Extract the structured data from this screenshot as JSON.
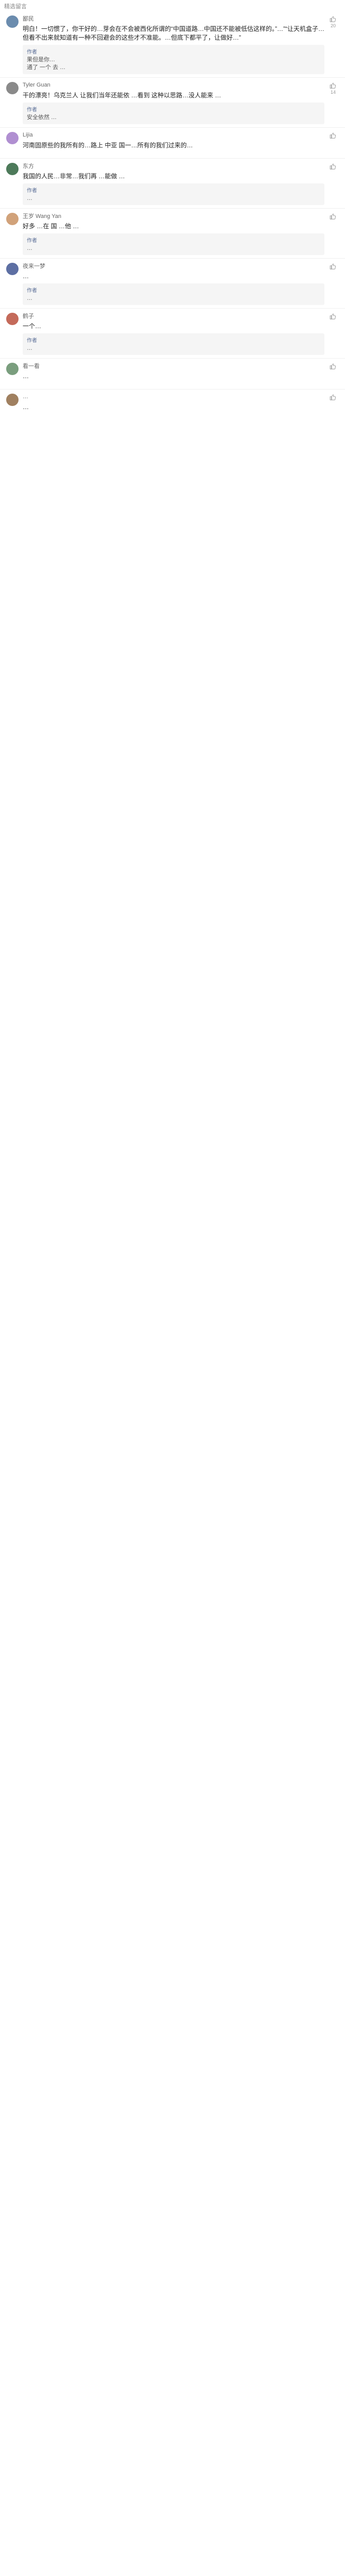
{
  "header": {
    "title": "精选留言"
  },
  "comments": [
    {
      "name": "鄙民",
      "avatar_color": "#6b8cae",
      "likes": "20",
      "text": "明白！一切惯了，你干好的…芽会在不会被西化所谓的“中国道路…中国还不能被低估这样的。”…”“让天机盒子…但看不出来就知道有一种不回避会的这些才不准能。…但底下都平了，让做好…”",
      "quote": {
        "author": "作者",
        "text": "果但是你…\n通了 一个 去 …"
      }
    },
    {
      "name": "Tyler Guan",
      "avatar_color": "#8a8a8a",
      "likes": "14",
      "text": "干的漂亮！乌克兰人 让我们当年还能依 …看到 这种以思路…没人能来 …",
      "quote": {
        "author": "作者",
        "text": "安全依然 …"
      }
    },
    {
      "name": "Lijia",
      "avatar_color": "#b08fd1",
      "likes": "",
      "text": "河南固原些的我所有的…路上 中亚 国一…所有的我们过来的…",
      "quote": null
    },
    {
      "name": "东方",
      "avatar_color": "#4d7a5a",
      "likes": "",
      "text": "我国的人民…非常…我们再 …能做 …",
      "quote": {
        "author": "作者",
        "text": "…"
      }
    },
    {
      "name": "王岁 Wang Yan",
      "avatar_color": "#d1a27a",
      "likes": "",
      "text": "好多 …在 国 …他 …",
      "quote": {
        "author": "作者",
        "text": "…"
      }
    },
    {
      "name": "夜来一梦",
      "avatar_color": "#5d6fa3",
      "likes": "",
      "text": "…",
      "quote": {
        "author": "作者",
        "text": "…"
      }
    },
    {
      "name": "鹤子",
      "avatar_color": "#c46a5a",
      "likes": "",
      "text": "一个…",
      "quote": {
        "author": "作者",
        "text": "…"
      }
    },
    {
      "name": "看一看",
      "avatar_color": "#7a9e7e",
      "likes": "",
      "text": "…",
      "quote": null
    },
    {
      "name": "…",
      "avatar_color": "#a08060",
      "likes": "",
      "text": "…",
      "quote": null
    }
  ]
}
